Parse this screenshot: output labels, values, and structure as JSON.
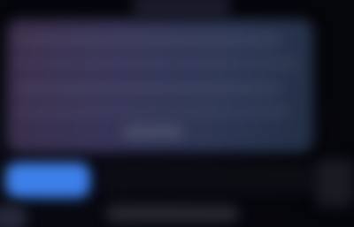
{
  "window": {
    "title": ""
  },
  "panel": {
    "rows": [
      "",
      "",
      "",
      ""
    ],
    "hint": ""
  },
  "actions": {
    "primary_label": "",
    "footer_text": "",
    "secondary_label": ""
  },
  "colors": {
    "background": "#05060b",
    "panel": "#363457",
    "primary_accent": "#3d7fe8"
  }
}
